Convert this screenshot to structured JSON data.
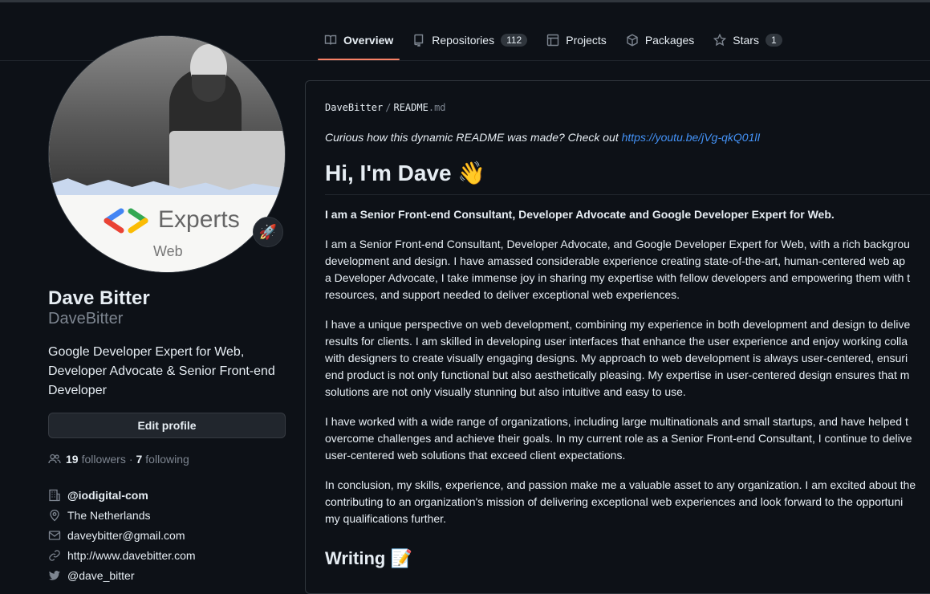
{
  "tabs": [
    {
      "label": "Overview",
      "icon": "book-icon",
      "active": true
    },
    {
      "label": "Repositories",
      "icon": "repo-icon",
      "count": "112"
    },
    {
      "label": "Projects",
      "icon": "table-icon"
    },
    {
      "label": "Packages",
      "icon": "package-icon"
    },
    {
      "label": "Stars",
      "icon": "star-icon",
      "count": "1"
    }
  ],
  "profile": {
    "avatar_experts": "Experts",
    "avatar_web": "Web",
    "status_emoji": "🚀",
    "name": "Dave Bitter",
    "login": "DaveBitter",
    "bio": "Google Developer Expert for Web, Developer Advocate & Senior Front-end Developer",
    "edit_label": "Edit profile",
    "followers_count": "19",
    "followers_label": "followers",
    "separator": "·",
    "following_count": "7",
    "following_label": "following",
    "org": "@iodigital-com",
    "location": "The Netherlands",
    "email": "daveybitter@gmail.com",
    "website": "http://www.davebitter.com",
    "twitter": "@dave_bitter"
  },
  "readme": {
    "owner": "DaveBitter",
    "sep": "/",
    "file_base": "README",
    "file_ext": ".md",
    "intro_text": "Curious how this dynamic README was made? Check out ",
    "intro_link": "https://youtu.be/jVg-qkQ01lI",
    "heading": "Hi, I'm Dave 👋",
    "lead": "I am a Senior Front-end Consultant, Developer Advocate and Google Developer Expert for Web.",
    "p1": [
      "I am a Senior Front-end Consultant, Developer Advocate, and Google Developer Expert for Web, with a rich backgrou",
      "development and design. I have amassed considerable experience creating state-of-the-art, human-centered web ap",
      "a Developer Advocate, I take immense joy in sharing my expertise with fellow developers and empowering them with t",
      "resources, and support needed to deliver exceptional web experiences."
    ],
    "p2": [
      "I have a unique perspective on web development, combining my experience in both development and design to delive",
      "results for clients. I am skilled in developing user interfaces that enhance the user experience and enjoy working colla",
      "with designers to create visually engaging designs. My approach to web development is always user-centered, ensuri",
      "end product is not only functional but also aesthetically pleasing. My expertise in user-centered design ensures that m",
      "solutions are not only visually stunning but also intuitive and easy to use."
    ],
    "p3": [
      "I have worked with a wide range of organizations, including large multinationals and small startups, and have helped t",
      "overcome challenges and achieve their goals. In my current role as a Senior Front-end Consultant, I continue to delive",
      "user-centered web solutions that exceed client expectations."
    ],
    "p4": [
      "In conclusion, my skills, experience, and passion make me a valuable asset to any organization. I am excited about the",
      "contributing to an organization's mission of delivering exceptional web experiences and look forward to the opportuni",
      "my qualifications further."
    ],
    "writing_heading": "Writing 📝"
  },
  "colors": {
    "accent_tab": "#f78166",
    "link": "#4493f8",
    "bg": "#0d1117"
  }
}
